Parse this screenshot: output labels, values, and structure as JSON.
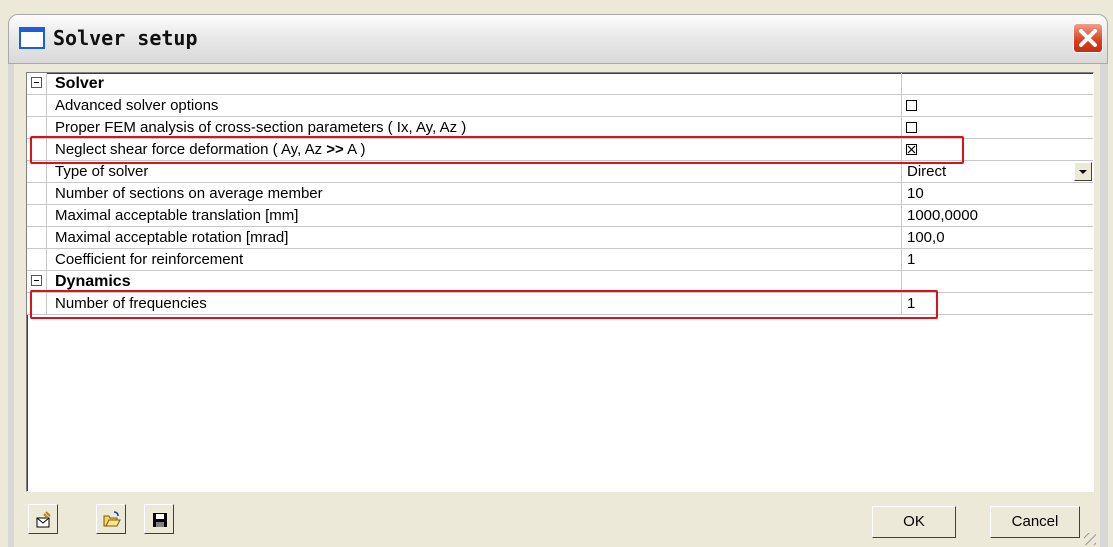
{
  "window": {
    "title": "Solver setup"
  },
  "grid": {
    "solver_section": "Solver",
    "advanced_solver_options": {
      "label": "Advanced solver options",
      "checked": false
    },
    "proper_fem": {
      "label": "Proper FEM analysis of cross-section parameters ( Ix, Ay, Az )",
      "checked": false
    },
    "neglect_shear": {
      "label_prefix": "Neglect shear force deformation ( Ay, Az ",
      "label_bold": ">>",
      "label_suffix": " A )",
      "checked": true
    },
    "type_of_solver": {
      "label": "Type of solver",
      "value": "Direct"
    },
    "number_of_sections": {
      "label": "Number of sections on average member",
      "value": "10"
    },
    "max_translation": {
      "label": "Maximal acceptable translation [mm]",
      "value": "1000,0000"
    },
    "max_rotation": {
      "label": "Maximal acceptable rotation [mrad]",
      "value": "100,0"
    },
    "coef_reinforcement": {
      "label": "Coefficient for reinforcement",
      "value": "1"
    },
    "dynamics_section": "Dynamics",
    "number_of_frequencies": {
      "label": "Number of frequencies",
      "value": "1"
    }
  },
  "buttons": {
    "ok": "OK",
    "cancel": "Cancel"
  },
  "icons": [
    "window-icon",
    "close-icon",
    "collapse-icon",
    "checkbox-icon",
    "dropdown-arrow-icon",
    "clear-icon",
    "open-folder-icon",
    "save-icon",
    "resize-grip-icon"
  ],
  "colors": {
    "highlight": "#e0101a",
    "close_button": "#d8401f"
  }
}
